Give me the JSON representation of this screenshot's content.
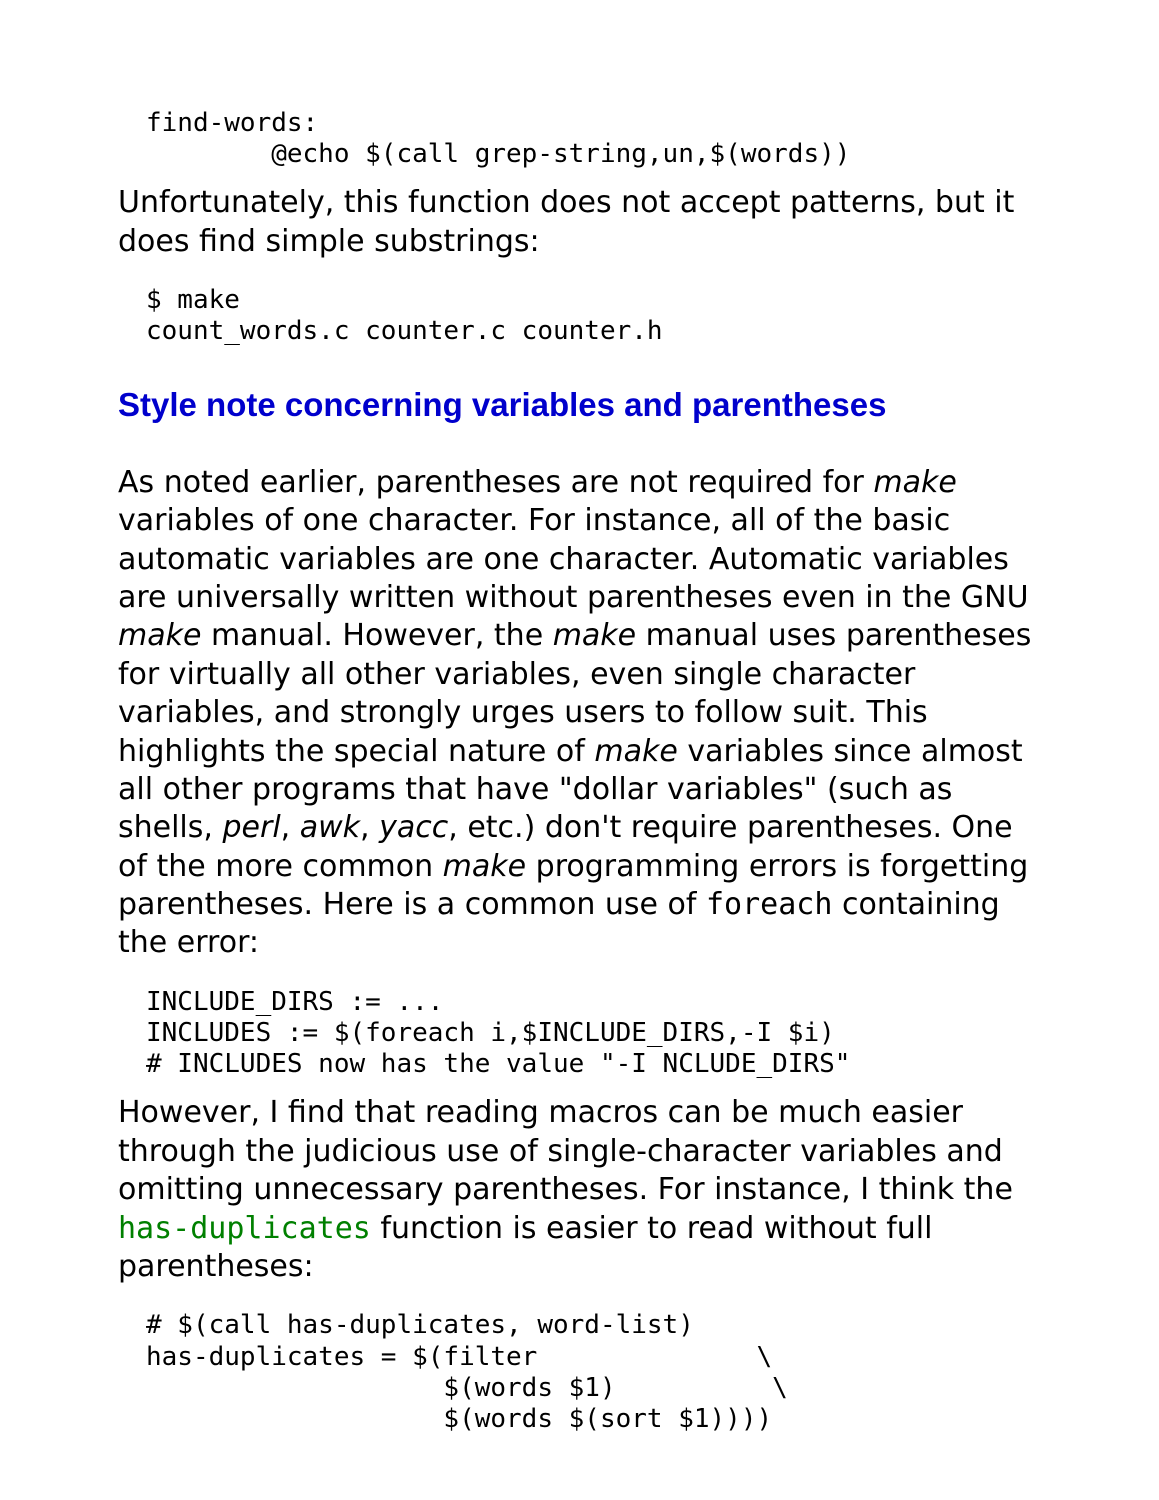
{
  "code1": "find-words:\n        @echo $(call grep-string,un,$(words))",
  "para1_a": "Unfortunately, this function does not accept patterns, but it does find simple substrings:",
  "code2": "$ make\ncount_words.c counter.c counter.h",
  "heading": "Style note concerning variables and parentheses",
  "p2": {
    "t1": "As noted earlier, parentheses are not required for ",
    "make1": "make",
    "t2": " variables of one character. For instance, all of the basic automatic variables are one character. Automatic variables are universally written without parentheses even in the GNU ",
    "make2": "make",
    "t3": " manual. However, the ",
    "make3": "make",
    "t4": " manual uses parentheses for virtually all other variables, even single character variables, and strongly urges users to follow suit. This highlights the special nature of ",
    "make4": "make",
    "t5": " variables since almost all other programs that have \"dollar variables\" (such as shells, ",
    "perl": "perl",
    "c1": ", ",
    "awk": "awk",
    "c2": ", ",
    "yacc": "yacc",
    "t6": ", etc.) don't require parentheses. One of the more common ",
    "make5": "make",
    "t7": " programming errors is forgetting parentheses. Here is a common use of ",
    "foreach": "foreach",
    "t8": " containing the error:"
  },
  "code3": "INCLUDE_DIRS := ...\nINCLUDES := $(foreach i,$INCLUDE_DIRS,-I $i)\n# INCLUDES now has the value \"-I NCLUDE_DIRS\"",
  "p3": {
    "t1": "However, I find that reading macros can be much easier through the judicious use of single-character variables and omitting unnecessary parentheses. For instance, I think the ",
    "link": "has-duplicates",
    "t2": " function is easier to read without full parentheses:"
  },
  "code4": "# $(call has-duplicates, word-list)\nhas-duplicates = $(filter              \\\n                   $(words $1)          \\\n                   $(words $(sort $1))))"
}
